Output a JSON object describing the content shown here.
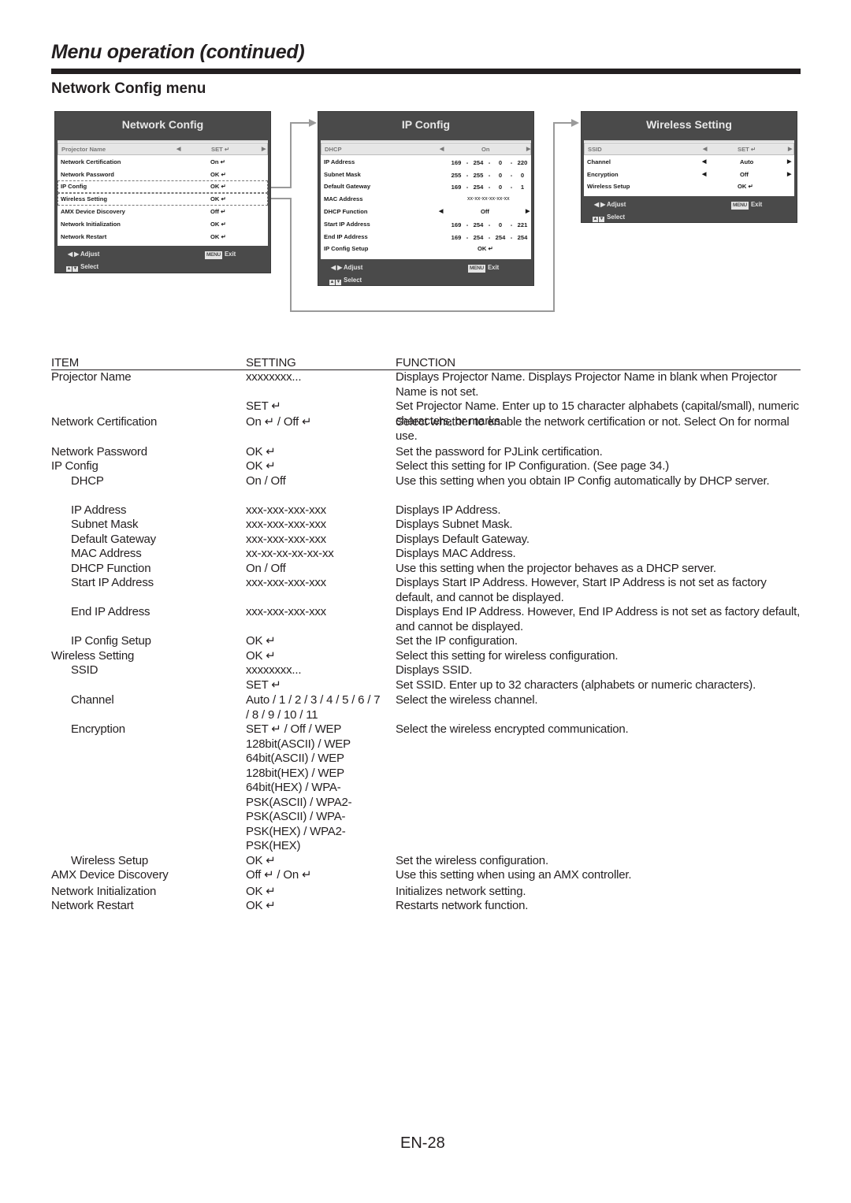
{
  "page": {
    "title": "Menu operation (continued)",
    "section_title": "Network Config menu",
    "page_number": "EN-28"
  },
  "icons": {
    "enter": "↵",
    "left_arrow": "◀",
    "right_arrow": "▶",
    "up": "▲",
    "down": "▼"
  },
  "menus": {
    "network_config": {
      "title": "Network Config",
      "rows": [
        {
          "label": "Projector Name",
          "value": "SET ↵",
          "selected": true
        },
        {
          "label": "Network Certification",
          "value": "On ↵"
        },
        {
          "label": "Network Password",
          "value": "OK ↵"
        },
        {
          "label": "IP Config",
          "value": "OK ↵"
        },
        {
          "label": "Wireless Setting",
          "value": "OK ↵"
        },
        {
          "label": "AMX Device Discovery",
          "value": "Off ↵"
        },
        {
          "label": "Network Initialization",
          "value": "OK ↵"
        },
        {
          "label": "Network Restart",
          "value": "OK ↵"
        }
      ],
      "footer": {
        "adjust": "Adjust",
        "select": "Select",
        "menu": "MENU",
        "exit": "Exit"
      }
    },
    "ip_config": {
      "title": "IP Config",
      "rows": [
        {
          "label": "DHCP",
          "value": "On",
          "selected": true
        },
        {
          "label": "IP Address",
          "octets": [
            "169",
            "254",
            "0",
            "220"
          ]
        },
        {
          "label": "Subnet Mask",
          "octets": [
            "255",
            "255",
            "0",
            "0"
          ]
        },
        {
          "label": "Default Gateway",
          "octets": [
            "169",
            "254",
            "0",
            "1"
          ]
        },
        {
          "label": "MAC Address",
          "value": "xx-xx-xx-xx-xx-xx"
        },
        {
          "label": "DHCP Function",
          "value": "Off"
        },
        {
          "label": "Start IP Address",
          "octets": [
            "169",
            "254",
            "0",
            "221"
          ]
        },
        {
          "label": "End IP Address",
          "octets": [
            "169",
            "254",
            "254",
            "254"
          ]
        },
        {
          "label": "IP Config Setup",
          "value": "OK ↵"
        }
      ],
      "footer": {
        "adjust": "Adjust",
        "select": "Select",
        "menu": "MENU",
        "exit": "Exit"
      }
    },
    "wireless_setting": {
      "title": "Wireless Setting",
      "rows": [
        {
          "label": "SSID",
          "value": "SET ↵",
          "selected": true
        },
        {
          "label": "Channel",
          "value": "Auto"
        },
        {
          "label": "Encryption",
          "value": "Off"
        },
        {
          "label": "Wireless Setup",
          "value": "OK ↵"
        }
      ],
      "footer": {
        "adjust": "Adjust",
        "select": "Select",
        "menu": "MENU",
        "exit": "Exit"
      }
    }
  },
  "table": {
    "headers": {
      "item": "ITEM",
      "setting": "SETTING",
      "function": "FUNCTION"
    },
    "rows": [
      {
        "item": "Projector Name",
        "setting": "xxxxxxxx...",
        "function": "Displays Projector Name. Displays Projector Name in blank when Projector Name is not set."
      },
      {
        "item": "",
        "setting": "SET ↵",
        "function": "Set Projector Name. Enter up to 15 character alphabets (capital/small), numeric characters, or marks."
      },
      {
        "item": "Network Certification",
        "setting": "On ↵ / Off ↵",
        "function": "Select whether to enable the network certification or not. Select On for normal use."
      },
      {
        "item": "Network Password",
        "setting": "OK ↵",
        "function": "Set the password for PJLink certification."
      },
      {
        "item": "IP Config",
        "setting": "OK ↵",
        "function": "Select this setting for IP Configuration. (See page 34.)"
      },
      {
        "item": "DHCP",
        "setting": "On / Off",
        "function": "Use this setting when you obtain IP Config automatically by DHCP server.",
        "indent": true
      },
      {
        "item": "IP Address",
        "setting": "xxx-xxx-xxx-xxx",
        "function": "Displays IP Address.",
        "indent": true
      },
      {
        "item": "Subnet Mask",
        "setting": "xxx-xxx-xxx-xxx",
        "function": "Displays Subnet Mask.",
        "indent": true
      },
      {
        "item": "Default Gateway",
        "setting": "xxx-xxx-xxx-xxx",
        "function": "Displays Default Gateway.",
        "indent": true
      },
      {
        "item": "MAC Address",
        "setting": "xx-xx-xx-xx-xx-xx",
        "function": "Displays MAC Address.",
        "indent": true
      },
      {
        "item": "DHCP Function",
        "setting": "On / Off",
        "function": "Use this setting when the projector behaves as a DHCP server.",
        "indent": true
      },
      {
        "item": "Start IP Address",
        "setting": "xxx-xxx-xxx-xxx",
        "function": "Displays Start IP Address. However, Start IP Address is not set as factory default, and cannot be displayed.",
        "indent": true
      },
      {
        "item": "End IP Address",
        "setting": "xxx-xxx-xxx-xxx",
        "function": "Displays End IP Address. However, End IP Address is not set as factory default, and cannot be displayed.",
        "indent": true
      },
      {
        "item": "IP Config Setup",
        "setting": "OK ↵",
        "function": "Set the IP configuration.",
        "indent": true
      },
      {
        "item": "Wireless Setting",
        "setting": "OK ↵",
        "function": "Select this setting for wireless configuration."
      },
      {
        "item": "SSID",
        "setting": "xxxxxxxx...",
        "function": "Displays SSID.",
        "indent": true
      },
      {
        "item": "",
        "setting": "SET ↵",
        "function": "Set SSID. Enter up to 32 characters (alphabets or numeric characters).",
        "indent": true
      },
      {
        "item": "Channel",
        "setting": "Auto / 1 / 2 / 3 / 4 / 5 / 6 / 7 / 8 / 9 / 10 / 11",
        "function": "Select the wireless channel.",
        "indent": true
      },
      {
        "item": "Encryption",
        "setting": "SET ↵ / Off / WEP 128bit(ASCII) / WEP 64bit(ASCII) / WEP 128bit(HEX) / WEP 64bit(HEX) / WPA-PSK(ASCII) / WPA2-PSK(ASCII) / WPA-PSK(HEX) / WPA2-PSK(HEX)",
        "function": "Select the wireless encrypted communication.",
        "indent": true
      },
      {
        "item": "Wireless Setup",
        "setting": "OK ↵",
        "function": "Set the wireless configuration.",
        "indent": true
      },
      {
        "item": "AMX Device Discovery",
        "setting": "Off ↵ / On ↵",
        "function": "Use this setting when using an AMX controller."
      },
      {
        "item": "Network Initialization",
        "setting": "OK ↵",
        "function": "Initializes network setting."
      },
      {
        "item": "Network Restart",
        "setting": "OK ↵",
        "function": "Restarts network function."
      }
    ]
  }
}
